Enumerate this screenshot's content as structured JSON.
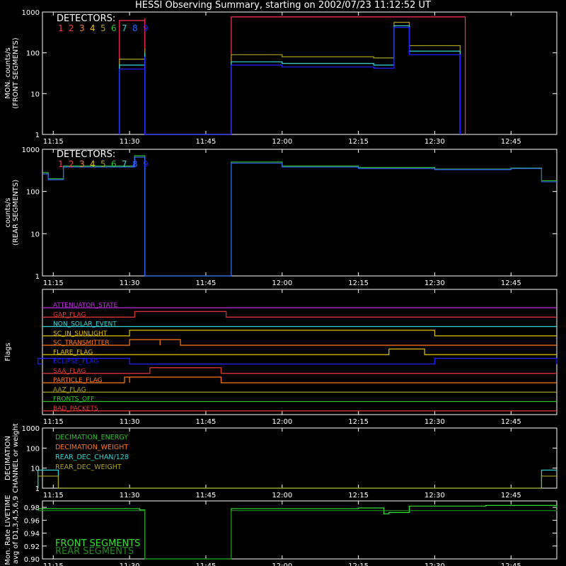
{
  "title": "HESSI Observing Summary, starting on 2002/07/23 11:12:52 UT",
  "colors": {
    "background": "#000000",
    "axis": "#ffffff",
    "det": [
      "#ff3355",
      "#e83a3a",
      "#ff7a1a",
      "#e0c000",
      "#a8a020",
      "#30c030",
      "#30d8d8",
      "#3060ff",
      "#2020ff"
    ]
  },
  "chart_data": [
    {
      "type": "line",
      "name": "front",
      "ylabel": "MON. counts/s (FRONT SEGMENTS)",
      "ylabel_lines": [
        "MON. counts/s",
        "(FRONT SEGMENTS)"
      ],
      "scale": "log",
      "ylim": [
        1,
        1000
      ],
      "y_ticks": [
        "1",
        "10",
        "100",
        "1000"
      ],
      "x_ticks": [
        "11:15",
        "11:30",
        "11:45",
        "12:00",
        "12:15",
        "12:30",
        "12:45"
      ],
      "legend_title": "DETECTORS:",
      "legend_items": [
        "1",
        "2",
        "3",
        "4",
        "5",
        "6",
        "7",
        "8",
        "9"
      ],
      "series": [
        {
          "label": "1",
          "color": "#ff3355",
          "points": [
            [
              "11:28",
              1
            ],
            [
              "11:28",
              620
            ],
            [
              "11:33",
              700
            ],
            [
              "11:33",
              1
            ],
            [
              "11:50",
              1
            ],
            [
              "11:50",
              760
            ],
            [
              "12:36",
              560
            ],
            [
              "12:36",
              1
            ]
          ]
        },
        {
          "label": "3",
          "color": "#a8a020",
          "points": [
            [
              "11:28",
              1
            ],
            [
              "11:28",
              70
            ],
            [
              "11:33",
              130
            ],
            [
              "11:33",
              1
            ],
            [
              "11:50",
              1
            ],
            [
              "11:50",
              90
            ],
            [
              "12:00",
              80
            ],
            [
              "12:18",
              75
            ],
            [
              "12:22",
              560
            ],
            [
              "12:25",
              150
            ],
            [
              "12:35",
              70
            ],
            [
              "12:35",
              1
            ]
          ]
        },
        {
          "label": "7",
          "color": "#30d8d8",
          "points": [
            [
              "11:28",
              1
            ],
            [
              "11:28",
              50
            ],
            [
              "11:33",
              100
            ],
            [
              "11:33",
              1
            ],
            [
              "11:50",
              1
            ],
            [
              "11:50",
              60
            ],
            [
              "12:00",
              55
            ],
            [
              "12:18",
              50
            ],
            [
              "12:22",
              460
            ],
            [
              "12:25",
              110
            ],
            [
              "12:35",
              40
            ],
            [
              "12:35",
              1
            ]
          ]
        },
        {
          "label": "8",
          "color": "#2020ff",
          "points": [
            [
              "11:28",
              1
            ],
            [
              "11:28",
              40
            ],
            [
              "11:33",
              80
            ],
            [
              "11:33",
              1
            ],
            [
              "11:50",
              1
            ],
            [
              "11:50",
              50
            ],
            [
              "12:00",
              45
            ],
            [
              "12:18",
              42
            ],
            [
              "12:22",
              420
            ],
            [
              "12:25",
              90
            ],
            [
              "12:35",
              30
            ],
            [
              "12:35",
              1
            ]
          ]
        }
      ]
    },
    {
      "type": "line",
      "name": "rear",
      "ylabel": "counts/s (REAR SEGMENTS)",
      "ylabel_lines": [
        "counts/s",
        "(REAR SEGMENTS)"
      ],
      "scale": "log",
      "ylim": [
        1,
        1000
      ],
      "y_ticks": [
        "1",
        "10",
        "100",
        "1000"
      ],
      "x_ticks": [
        "11:15",
        "11:30",
        "11:45",
        "12:00",
        "12:15",
        "12:30",
        "12:45"
      ],
      "legend_title": "DETECTORS:",
      "legend_items": [
        "1",
        "2",
        "3",
        "4",
        "5",
        "6",
        "7",
        "8",
        "9"
      ],
      "series": [
        {
          "label": "6",
          "color": "#30c030",
          "points": [
            [
              "11:13",
              280
            ],
            [
              "11:14",
              200
            ],
            [
              "11:17",
              200
            ],
            [
              "11:17",
              400
            ],
            [
              "11:31",
              700
            ],
            [
              "11:33",
              700
            ],
            [
              "11:33",
              1
            ],
            [
              "11:50",
              1
            ],
            [
              "11:50",
              500
            ],
            [
              "12:00",
              400
            ],
            [
              "12:15",
              370
            ],
            [
              "12:30",
              340
            ],
            [
              "12:45",
              360
            ],
            [
              "12:51",
              340
            ],
            [
              "12:51",
              180
            ],
            [
              "12:54",
              180
            ]
          ]
        },
        {
          "label": "8",
          "color": "#3060ff",
          "points": [
            [
              "11:13",
              260
            ],
            [
              "11:14",
              190
            ],
            [
              "11:17",
              190
            ],
            [
              "11:17",
              380
            ],
            [
              "11:31",
              650
            ],
            [
              "11:33",
              650
            ],
            [
              "11:33",
              1
            ],
            [
              "11:50",
              1
            ],
            [
              "11:50",
              470
            ],
            [
              "12:00",
              380
            ],
            [
              "12:15",
              350
            ],
            [
              "12:30",
              330
            ],
            [
              "12:45",
              350
            ],
            [
              "12:51",
              330
            ],
            [
              "12:51",
              170
            ],
            [
              "12:54",
              170
            ]
          ]
        }
      ]
    },
    {
      "type": "line",
      "name": "flags",
      "ylabel": "Flags",
      "x_ticks": [
        "11:15",
        "11:30",
        "11:45",
        "12:00",
        "12:15",
        "12:30",
        "12:45"
      ],
      "flags": [
        {
          "label": "ATTENUATOR_STATE",
          "color": "#c030e0",
          "highs": []
        },
        {
          "label": "GAP_FLAG",
          "color": "#e83a3a",
          "highs": [
            [
              "11:31",
              "11:49"
            ]
          ]
        },
        {
          "label": "NON_SOLAR_EVENT",
          "color": "#30d8d8",
          "highs": []
        },
        {
          "label": "SC_IN_SUNLIGHT",
          "color": "#e0c000",
          "highs": [
            [
              "11:30",
              "12:30"
            ]
          ]
        },
        {
          "label": "SC_TRANSMITTER",
          "color": "#ff7a1a",
          "highs": [
            [
              "11:30",
              "11:36"
            ],
            [
              "11:36",
              "11:40"
            ]
          ]
        },
        {
          "label": "FLARE_FLAG",
          "color": "#e0c000",
          "highs": [
            [
              "12:21",
              "12:28"
            ]
          ]
        },
        {
          "label": "ECLIPSE_FLAG",
          "color": "#2020ff",
          "highs": [
            [
              "11:12",
              "11:30"
            ],
            [
              "12:30",
              "12:54"
            ]
          ]
        },
        {
          "label": "SAA_FLAG",
          "color": "#e83a3a",
          "highs": [
            [
              "11:34",
              "11:48"
            ]
          ]
        },
        {
          "label": "PARTICLE_FLAG",
          "color": "#ff7a1a",
          "highs": [
            [
              "11:29",
              "11:30"
            ],
            [
              "11:30",
              "11:48"
            ]
          ]
        },
        {
          "label": "AAZ_FLAG",
          "color": "#a8a020",
          "highs": []
        },
        {
          "label": "FRONTS_OFF",
          "color": "#30c030",
          "highs": []
        },
        {
          "label": "BAD_PACKETS",
          "color": "#e83a3a",
          "highs": []
        }
      ]
    },
    {
      "type": "line",
      "name": "decimation",
      "ylabel": "DECIMATION CHANNEL or weight",
      "ylabel_lines": [
        "DECIMATION",
        "CHANNEL or weight"
      ],
      "scale": "log",
      "ylim": [
        1,
        1000
      ],
      "y_ticks": [
        "1",
        "10",
        "100",
        "1000"
      ],
      "x_ticks": [
        "11:15",
        "11:30",
        "11:45",
        "12:00",
        "12:15",
        "12:30",
        "12:45"
      ],
      "legend_items": [
        "DECIMATION_ENERGY",
        "DECIMATION_WEIGHT",
        "REAR_DEC_CHAN/128",
        "REAR_DEC_WEIGHT"
      ],
      "legend_colors": [
        "#30c030",
        "#ff7a1a",
        "#30d8d8",
        "#a8a020"
      ],
      "series": [
        {
          "label": "REAR_DEC_CHAN/128",
          "color": "#30d8d8",
          "points": [
            [
              "11:12",
              1
            ],
            [
              "11:12",
              8
            ],
            [
              "11:16",
              8
            ],
            [
              "11:16",
              1
            ],
            [
              "12:51",
              1
            ],
            [
              "12:51",
              8
            ],
            [
              "12:54",
              8
            ]
          ]
        },
        {
          "label": "REAR_DEC_WEIGHT",
          "color": "#a8a020",
          "points": [
            [
              "11:12",
              4
            ],
            [
              "11:16",
              4
            ],
            [
              "11:16",
              1
            ],
            [
              "12:51",
              1
            ],
            [
              "12:51",
              4
            ],
            [
              "12:54",
              4
            ]
          ]
        }
      ]
    },
    {
      "type": "line",
      "name": "livetime",
      "ylabel": "Mon. Rate LIVETIME avg of D1,3,4,5,6,9",
      "ylabel_lines": [
        "Mon. Rate LIVETIME",
        "avg of D1,3,4,5,6,9"
      ],
      "ylim": [
        0.9,
        0.99
      ],
      "y_ticks": [
        "0.90",
        "0.92",
        "0.94",
        "0.96",
        "0.98"
      ],
      "x_ticks": [
        "11:15",
        "11:30",
        "11:45",
        "12:00",
        "12:15",
        "12:30",
        "12:45"
      ],
      "legend_items": [
        "FRONT SEGMENTS",
        "REAR SEGMENTS"
      ],
      "legend_colors": [
        "#30e030",
        "#208a20"
      ],
      "series": [
        {
          "label": "FRONT SEGMENTS",
          "color": "#30e030",
          "points": [
            [
              "11:12",
              0.978
            ],
            [
              "11:32",
              0.976
            ],
            [
              "11:33",
              0.975
            ],
            [
              "11:33",
              0.9
            ],
            [
              "11:50",
              0.9
            ],
            [
              "11:50",
              0.978
            ],
            [
              "12:15",
              0.979
            ],
            [
              "12:20",
              0.97
            ],
            [
              "12:21",
              0.972
            ],
            [
              "12:25",
              0.982
            ],
            [
              "12:40",
              0.983
            ],
            [
              "12:54",
              0.979
            ]
          ]
        },
        {
          "label": "REAR SEGMENTS",
          "color": "#208a20",
          "points": [
            [
              "11:12",
              0.975
            ],
            [
              "11:33",
              0.972
            ],
            [
              "11:33",
              0.9
            ],
            [
              "11:50",
              0.9
            ],
            [
              "11:50",
              0.975
            ],
            [
              "12:54",
              0.976
            ]
          ]
        }
      ]
    }
  ]
}
